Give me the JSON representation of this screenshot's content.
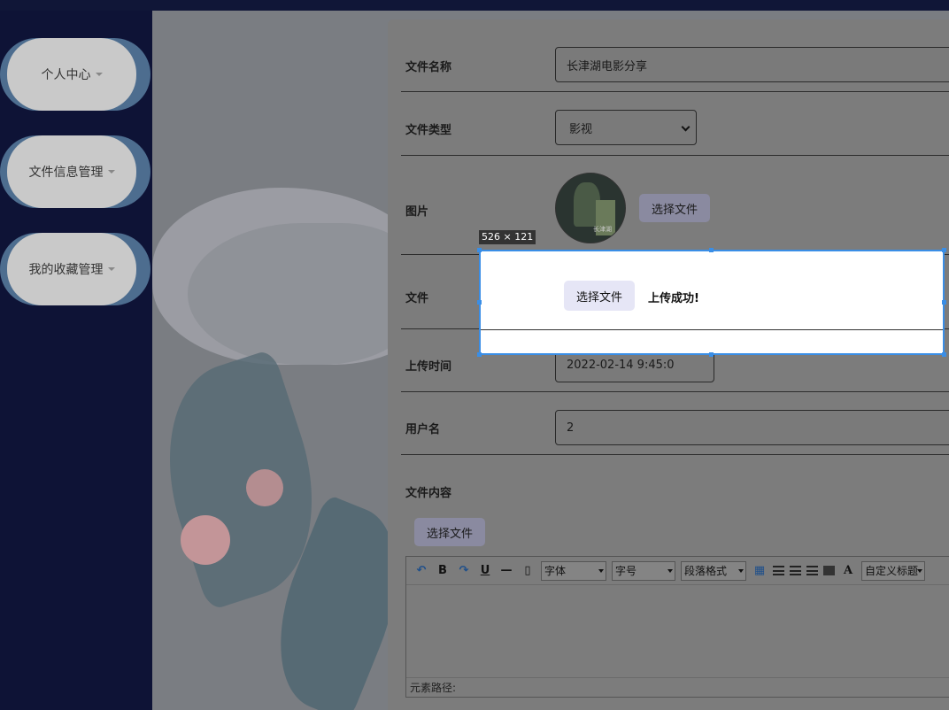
{
  "sidebar": {
    "items": [
      {
        "label": "个人中心"
      },
      {
        "label": "文件信息管理"
      },
      {
        "label": "我的收藏管理"
      }
    ]
  },
  "form": {
    "file_name": {
      "label": "文件名称",
      "value": "长津湖电影分享"
    },
    "file_type": {
      "label": "文件类型",
      "value": "影视"
    },
    "image": {
      "label": "图片",
      "button": "选择文件",
      "thumb_caption": "长津湖"
    },
    "file": {
      "label": "文件",
      "button": "选择文件",
      "status": "上传成功!"
    },
    "upload_time": {
      "label": "上传时间",
      "value": "2022-02-14 9:45:0"
    },
    "username": {
      "label": "用户名",
      "value": "2"
    },
    "content": {
      "label": "文件内容",
      "button": "选择文件"
    }
  },
  "overlay": {
    "size_tag": "526 × 121"
  },
  "editor": {
    "bold": "B",
    "underline": "U",
    "font_label": "字体",
    "size_label": "字号",
    "paragraph_label": "段落格式",
    "text_color": "A",
    "custom_title": "自定义标题",
    "path_label": "元素路径:"
  },
  "colors": {
    "sidebar_bg": "#0e1336",
    "sidebar_pill": "#c9c9c9",
    "sidebar_pill_shadow": "#4d6d8f",
    "selection": "#3a8ee6"
  }
}
